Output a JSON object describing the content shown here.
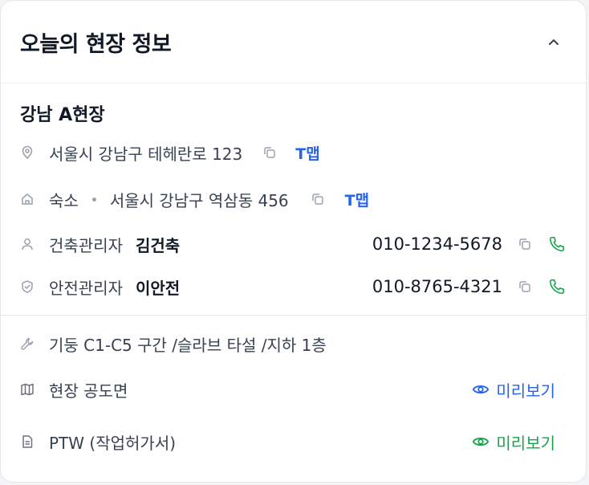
{
  "header": {
    "title": "오늘의 현장 정보"
  },
  "site": {
    "name": "강남 A현장",
    "address": "서울시 강남구 테헤란로 123",
    "address_map_label": "T맵",
    "lodging_label": "숙소",
    "lodging_address": "서울시 강남구 역삼동 456",
    "lodging_map_label": "T맵"
  },
  "contacts": [
    {
      "role": "건축관리자",
      "name": "김건축",
      "phone": "010-1234-5678"
    },
    {
      "role": "안전관리자",
      "name": "이안전",
      "phone": "010-8765-4321"
    }
  ],
  "work": {
    "description": "기둥 C1-C5 구간 /슬라브 타설 /지하 1층"
  },
  "documents": [
    {
      "label": "현장 공도면",
      "action": "미리보기",
      "action_color": "#2563eb"
    },
    {
      "label": "PTW (작업허가서)",
      "action": "미리보기",
      "action_color": "#16a34a"
    }
  ],
  "colors": {
    "accent_blue": "#2563eb",
    "accent_green": "#16a34a",
    "icon_gray": "#9ca3af"
  }
}
